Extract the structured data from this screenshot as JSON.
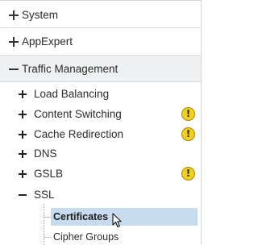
{
  "nav": {
    "sections": [
      {
        "label": "System",
        "expanded": false
      },
      {
        "label": "AppExpert",
        "expanded": false
      },
      {
        "label": "Traffic Management",
        "expanded": true
      }
    ],
    "traffic_items": [
      {
        "label": "Load Balancing",
        "warning": false
      },
      {
        "label": "Content Switching",
        "warning": true
      },
      {
        "label": "Cache Redirection",
        "warning": true
      },
      {
        "label": "DNS",
        "warning": false
      },
      {
        "label": "GSLB",
        "warning": true
      },
      {
        "label": "SSL",
        "expanded": true
      }
    ],
    "ssl_children": [
      {
        "label": "Certificates",
        "selected": true
      },
      {
        "label": "Cipher Groups",
        "selected": false
      }
    ],
    "warning_glyph": "!",
    "colors": {
      "selected_bg": "#c6dcee",
      "warning": "#f2d219",
      "expanded_section_bg": "#eef0f2"
    }
  }
}
